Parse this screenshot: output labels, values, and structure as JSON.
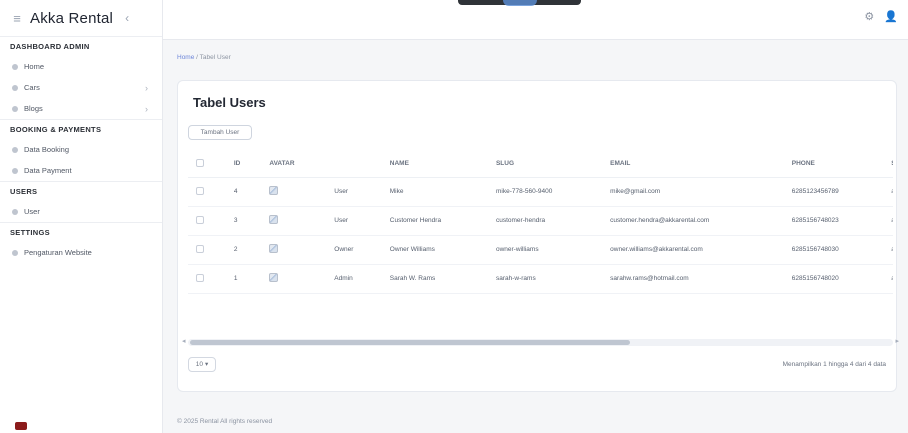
{
  "sidebar": {
    "app_title": "Akka Rental",
    "collapse_icon": "chevron-left-icon",
    "logo_icon": "menu-icon",
    "sections": [
      {
        "title": "DASHBOARD ADMIN",
        "items": [
          {
            "label": "Home",
            "has_chevron": false
          },
          {
            "label": "Cars",
            "has_chevron": true
          },
          {
            "label": "Blogs",
            "has_chevron": true
          }
        ]
      },
      {
        "title": "BOOKING & PAYMENTS",
        "items": [
          {
            "label": "Data Booking",
            "has_chevron": false
          },
          {
            "label": "Data Payment",
            "has_chevron": false
          }
        ]
      },
      {
        "title": "USERS",
        "items": [
          {
            "label": "User",
            "has_chevron": false
          }
        ]
      },
      {
        "title": "SETTINGS",
        "items": [
          {
            "label": "Pengaturan Website",
            "has_chevron": false
          }
        ]
      }
    ]
  },
  "topbar": {
    "icons": [
      "settings-icon",
      "user-icon"
    ]
  },
  "breadcrumb": {
    "home": "Home",
    "separator": "/",
    "current": "Tabel User"
  },
  "card": {
    "title": "Tabel Users",
    "add_button": "Tambah User",
    "table": {
      "headers": [
        "",
        "ID",
        "AVATAR",
        "",
        "NAME",
        "SLUG",
        "EMAIL",
        "PHONE",
        "STATUS"
      ],
      "rows": [
        {
          "id": "4",
          "role": "User",
          "name": "Mike",
          "slug": "mike-778-560-9400",
          "email": "mike@gmail.com",
          "phone": "6285123456789",
          "status": "active"
        },
        {
          "id": "3",
          "role": "User",
          "name": "Customer Hendra",
          "slug": "customer-hendra",
          "email": "customer.hendra@akkarental.com",
          "phone": "6285156748023",
          "status": "active"
        },
        {
          "id": "2",
          "role": "Owner",
          "name": "Owner Williams",
          "slug": "owner-williams",
          "email": "owner.williams@akkarental.com",
          "phone": "6285156748030",
          "status": "active"
        },
        {
          "id": "1",
          "role": "Admin",
          "name": "Sarah W. Rams",
          "slug": "sarah-w-rams",
          "email": "sarahw.rams@hotmail.com",
          "phone": "6285156748020",
          "status": "active"
        }
      ]
    },
    "page_size": "10",
    "pagination_text": "Menampilkan 1 hingga 4 dari 4 data"
  },
  "footer": {
    "text": "© 2025 Rental All rights reserved"
  }
}
